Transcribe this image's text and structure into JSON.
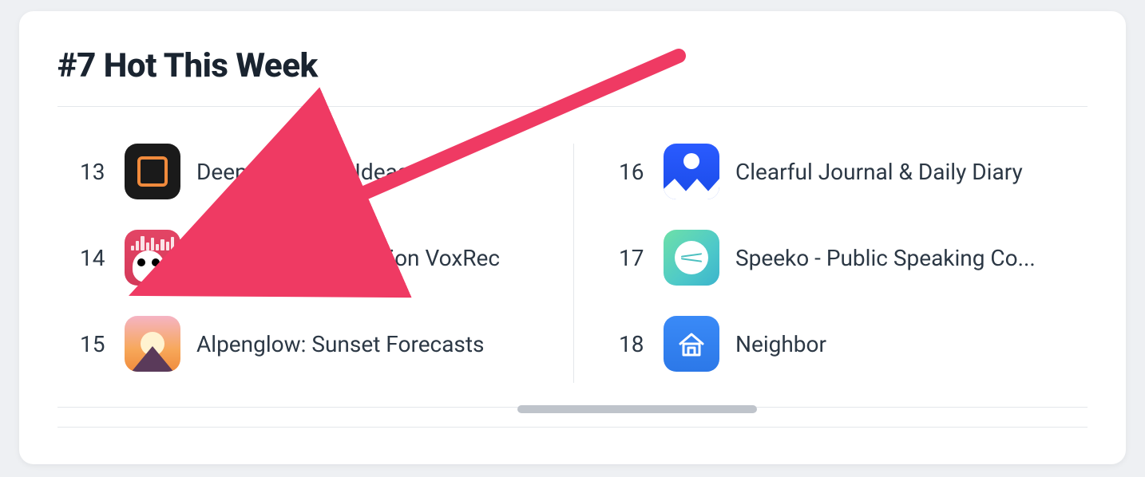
{
  "section": {
    "title": "#7 Hot This Week"
  },
  "apps": {
    "left": [
      {
        "rank": "13",
        "name": "Deepstash: Key Ideas",
        "icon": "deepstash"
      },
      {
        "rank": "14",
        "name": "Voice to Text Dictation VoxRec",
        "icon": "voxrec"
      },
      {
        "rank": "15",
        "name": "Alpenglow: Sunset Forecasts",
        "icon": "alpenglow"
      }
    ],
    "right": [
      {
        "rank": "16",
        "name": "Clearful Journal & Daily Diary",
        "icon": "clearful"
      },
      {
        "rank": "17",
        "name": "Speeko - Public Speaking Co...",
        "icon": "speeko"
      },
      {
        "rank": "18",
        "name": "Neighbor",
        "icon": "neighbor"
      }
    ]
  },
  "annotation": {
    "arrow_color": "#ef3a63"
  }
}
